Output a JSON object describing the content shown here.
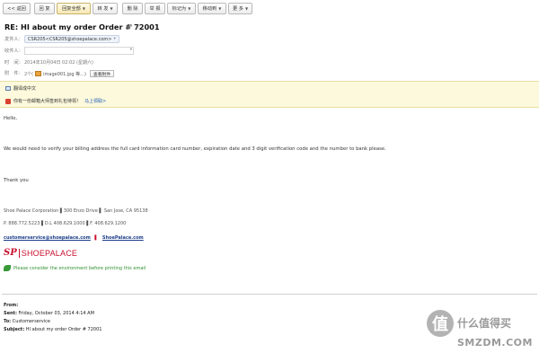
{
  "toolbar": {
    "back": "<< 返回",
    "reply": "回 复",
    "reply_all": "回复全部",
    "forward": "转 发",
    "delete": "删 除",
    "report": "举 报",
    "mark_as": "标记为",
    "move_to": "移动到",
    "more": "更 多"
  },
  "header": {
    "subject": "RE: HI about my order Order # 72001",
    "from_label": "发件人：",
    "from_chip": "CSR205<CSR205@shoepalace.com>",
    "to_label": "收件人：",
    "time_label": "时　间：",
    "time_value": "2014年10月04日 02:02 (星期六)",
    "attach_label": "附　件：",
    "attach_count": "2个(",
    "attach_name": "image001.jpg 等...)",
    "attach_button": "查看附件"
  },
  "notice": {
    "translate": "翻译成中文",
    "promo": "你有一份邮箱大师签到礼包待领！",
    "promo_link": "马上领取>"
  },
  "body": {
    "greeting": "Hello,",
    "paragraph": "We would need to verify your billing address the full card information card number, expiration date and 3 digit verification code and the number to bank please.",
    "thanks": "Thank you"
  },
  "signature": {
    "address": "Shoe Palace Corporation ▌300 Enzo Drive ▌ San Jose, CA 95138",
    "phones": "P. 888.772.5223 ▌D.L 408.629.1000 ▌F. 408.629.1200",
    "email": "customerservice@shoepalace.com",
    "separator": "▌",
    "site": "ShoePalace.com",
    "logo_mark": "SP",
    "logo_text": "SHOEPALACE",
    "eco": "Please consider the environment before printing this email"
  },
  "forwarded": {
    "from_label": "From:",
    "sent_label": "Sent:",
    "sent_value": "Friday, October 03, 2014 4:14 AM",
    "to_label": "To:",
    "to_value": "Customerservice",
    "subject_label": "Subject:",
    "subject_value": "HI about my order Order # 72001"
  },
  "watermark": {
    "mark": "值",
    "cn": "什么值得买",
    "en": "SMZDM.COM"
  },
  "colors": {
    "link": "#1d58b8",
    "brand_red": "#c8102e",
    "eco_green": "#2f8f2f",
    "notice_bg": "#fcf9dc"
  }
}
